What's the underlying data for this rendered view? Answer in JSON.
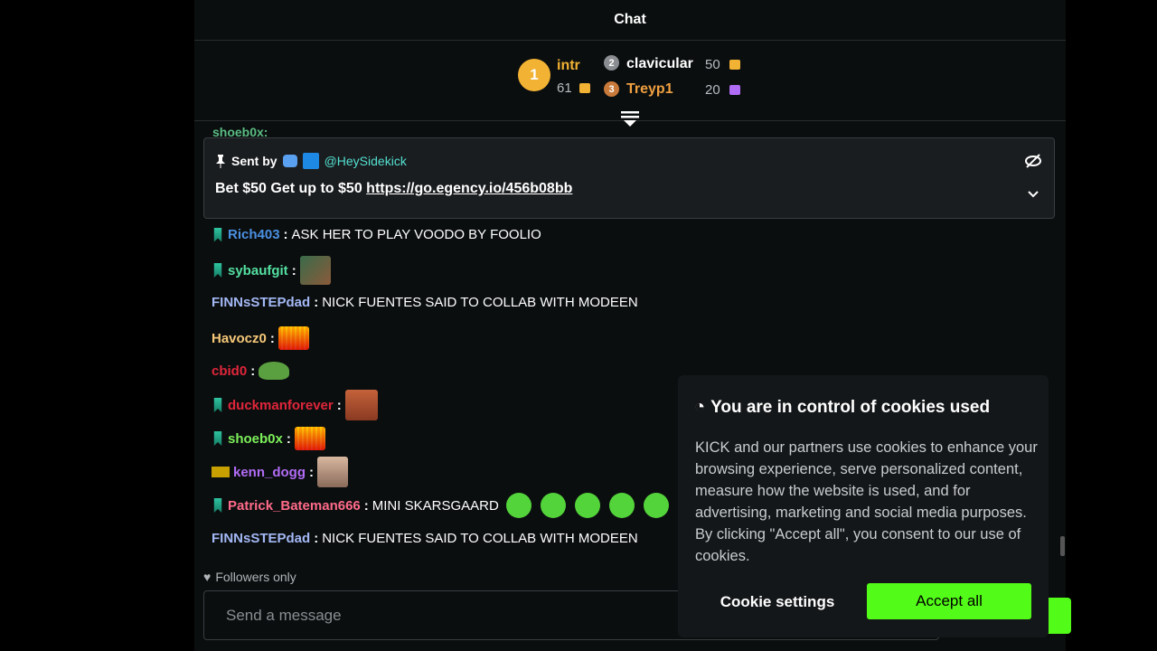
{
  "chat": {
    "title": "Chat",
    "leaderboard": [
      {
        "rank": "1",
        "name": "intr",
        "count": "61",
        "name_color": "#f2b233",
        "gift_color": "#f2b233"
      },
      {
        "rank": "2",
        "name": "clavicular",
        "count": "50",
        "name_color": "#ffffff",
        "gift_color": "#f2b233"
      },
      {
        "rank": "3",
        "name": "Treyp1",
        "count": "20",
        "name_color": "#f0a040",
        "gift_color": "#b16cf5"
      }
    ],
    "partial_message": "shoeb0x:",
    "pinned": {
      "sent_by_label": "Sent by",
      "author": "@HeySidekick",
      "text": "Bet $50 Get up to $50",
      "link": "https://go.egency.io/456b08bb",
      "icons": [
        "pin-icon",
        "robot-icon",
        "hammer-icon",
        "eye-off-icon",
        "chevron-down-icon"
      ]
    },
    "messages": [
      {
        "user": "Rich403",
        "color": "#4a90e2",
        "badge": true,
        "text": "ASK HER TO PLAY VOODO BY FOOLIO",
        "emotes": []
      },
      {
        "user": "sybaufgit",
        "color": "#53e0a0",
        "badge": true,
        "text": "",
        "emotes": [
          "photo"
        ]
      },
      {
        "user": "FINNsSTEPdad",
        "color": "#a3b8f5",
        "badge": false,
        "text": "NICK FUENTES SAID TO COLLAB WITH MODEEN",
        "emotes": []
      },
      {
        "user": "Havocz0",
        "color": "#f5c878",
        "badge": false,
        "text": "",
        "emotes": [
          "equalizer"
        ]
      },
      {
        "user": "cbid0",
        "color": "#e0263a",
        "badge": false,
        "text": "",
        "emotes": [
          "frog"
        ]
      },
      {
        "user": "duckmanforever",
        "color": "#e0263a",
        "badge": true,
        "text": "",
        "emotes": [
          "face"
        ]
      },
      {
        "user": "shoeb0x",
        "color": "#7cf05a",
        "badge": true,
        "text": "",
        "emotes": [
          "equalizer"
        ]
      },
      {
        "user": "kenn_dogg",
        "color": "#b16cf5",
        "badge": true,
        "text": "",
        "emotes": [
          "face2"
        ]
      },
      {
        "user": "Patrick_Bateman666",
        "color": "#ff6b8a",
        "badge": true,
        "text": "MINI SKARSGAARD",
        "emotes": [
          "green",
          "green",
          "green",
          "green",
          "green"
        ]
      },
      {
        "user": "FINNsSTEPdad",
        "color": "#a3b8f5",
        "badge": false,
        "text": "NICK FUENTES SAID TO COLLAB WITH MODEEN",
        "emotes": []
      }
    ],
    "followers_only": "Followers only",
    "input_placeholder": "Send a message"
  },
  "cookie": {
    "title": "You are in control of cookies used",
    "body": "KICK and our partners use cookies to enhance your browsing experience, serve personalized content, measure how the website is used, and for advertising, marketing and social media purposes. By clicking \"Accept all\", you consent to our use of cookies.",
    "settings_label": "Cookie settings",
    "accept_label": "Accept all",
    "accent": "#53fc18"
  }
}
